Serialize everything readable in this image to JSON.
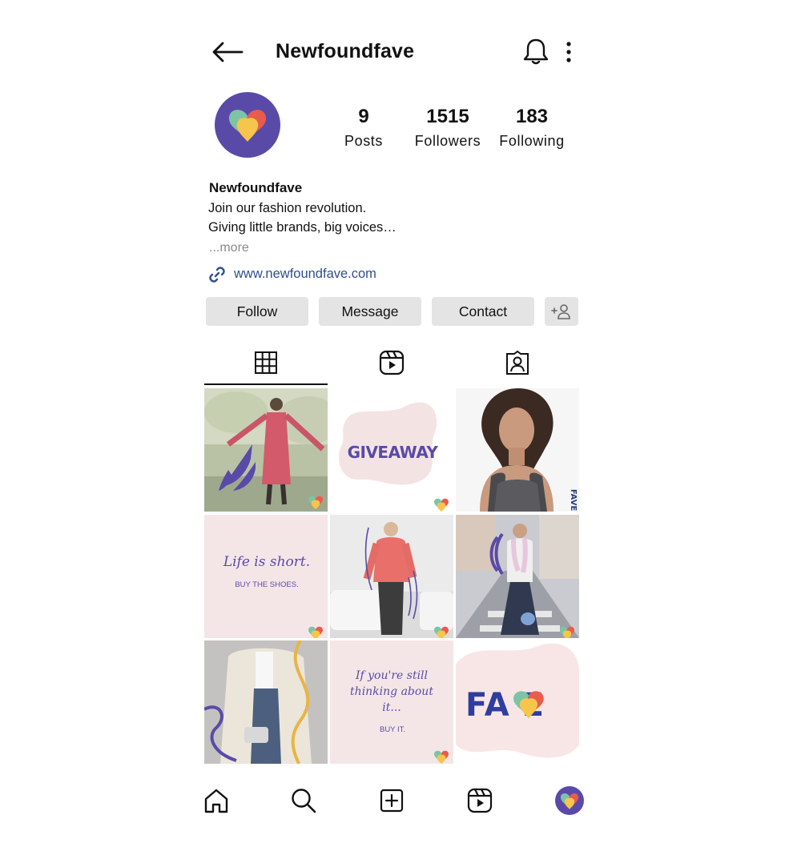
{
  "header": {
    "title": "Newfoundfave",
    "back_icon": "arrow-left-icon",
    "bell_icon": "bell-icon",
    "more_icon": "more-vertical-icon"
  },
  "profile": {
    "avatar_icon": "heart-logo-icon",
    "stats": [
      {
        "value": "9",
        "label": "Posts"
      },
      {
        "value": "1515",
        "label": "Followers"
      },
      {
        "value": "183",
        "label": "Following"
      }
    ],
    "name": "Newfoundfave",
    "bio_lines": [
      "Join our fashion revolution.",
      "Giving little brands, big voices…"
    ],
    "more": "...more",
    "link": "www.newfoundfave.com"
  },
  "actions": {
    "follow": "Follow",
    "message": "Message",
    "contact": "Contact",
    "add_person_icon": "add-person-icon"
  },
  "tabs": [
    "grid-icon",
    "reels-icon",
    "tagged-icon"
  ],
  "posts": [
    {
      "kind": "photo",
      "desc": "woman in floral dress"
    },
    {
      "kind": "graphic",
      "text": "GIVEAWAY"
    },
    {
      "kind": "photo",
      "desc": "woman portrait",
      "side_text": "FAVE"
    },
    {
      "kind": "graphic",
      "text": "Life is short.",
      "sub": "BUY THE SHOES."
    },
    {
      "kind": "photo",
      "desc": "woman in red sweater"
    },
    {
      "kind": "photo",
      "desc": "woman on street"
    },
    {
      "kind": "photo",
      "desc": "woman in cardigan"
    },
    {
      "kind": "graphic",
      "text": "If you're still thinking about it...",
      "sub": "BUY IT."
    },
    {
      "kind": "graphic",
      "text": "FA E"
    }
  ],
  "bottom_nav": [
    "home-icon",
    "search-icon",
    "add-post-icon",
    "reels-icon",
    "profile-avatar"
  ],
  "colors": {
    "brand_purple": "#5a4aa8",
    "graphic_bg": "#f4e6e7",
    "heart_green": "#7cc4a4",
    "heart_red": "#e95c4b",
    "heart_yellow": "#f6c54b",
    "link_blue": "#2f4f8f",
    "button_gray": "#e4e4e4"
  }
}
